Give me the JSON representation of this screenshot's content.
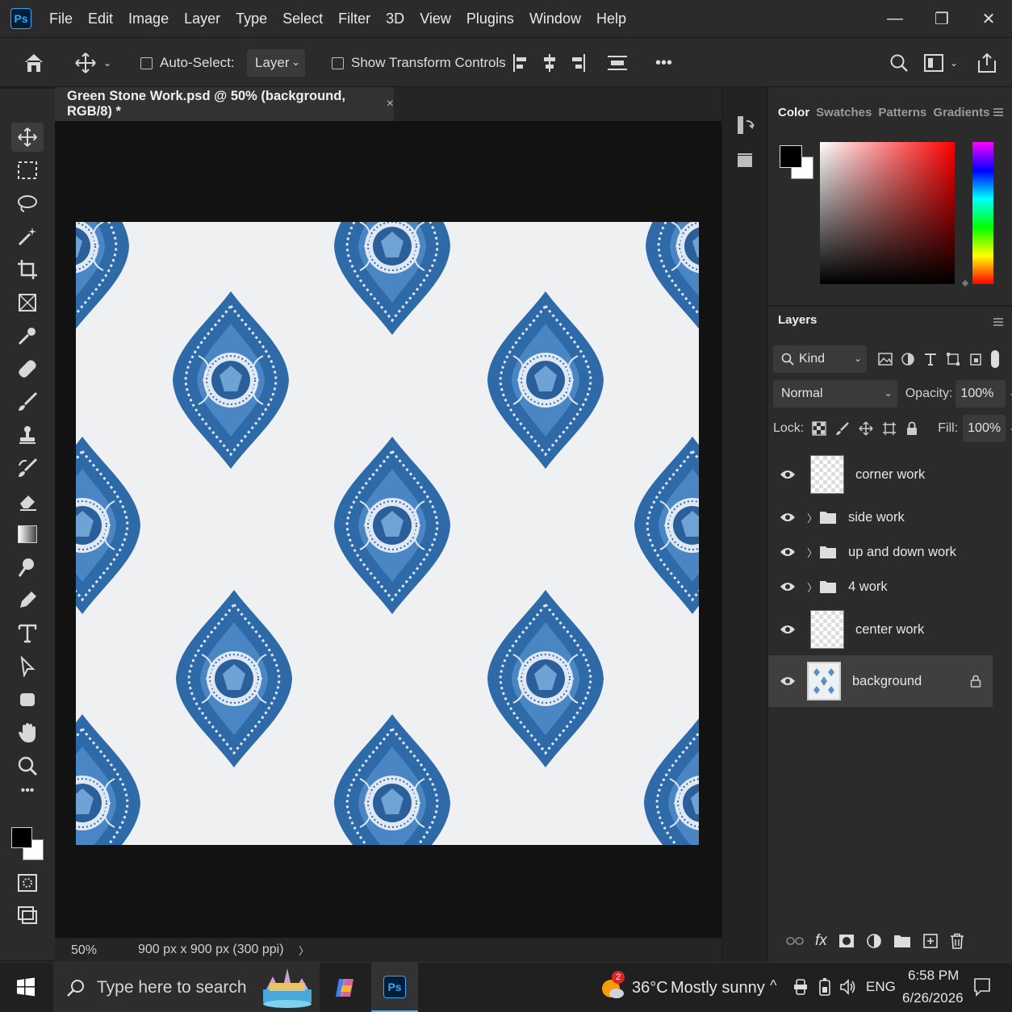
{
  "app": {
    "logo": "Ps"
  },
  "menu": [
    "File",
    "Edit",
    "Image",
    "Layer",
    "Type",
    "Select",
    "Filter",
    "3D",
    "View",
    "Plugins",
    "Window",
    "Help"
  ],
  "window_controls": {
    "minimize": "—",
    "restore": "❐",
    "close": "✕"
  },
  "options": {
    "auto_select_label": "Auto-Select:",
    "layer_select_value": "Layer",
    "show_transform_label": "Show Transform Controls",
    "more": "•••"
  },
  "document": {
    "tab_title": "Green Stone Work.psd @ 50% (background, RGB/8) *",
    "close": "×",
    "zoom": "50%",
    "doc_info": "900 px x 900 px (300 ppi)",
    "status_arrow": "〉"
  },
  "color_panel": {
    "tabs": [
      "Color",
      "Swatches",
      "Patterns",
      "Gradients"
    ],
    "active_tab": "Color",
    "foreground": "#000000",
    "background": "#ffffff"
  },
  "layers_panel": {
    "title": "Layers",
    "filter_kind": "Kind",
    "blend_mode": "Normal",
    "opacity_label": "Opacity:",
    "opacity_value": "100%",
    "lock_label": "Lock:",
    "fill_label": "Fill:",
    "fill_value": "100%",
    "layers": [
      {
        "name": "corner work",
        "type": "layer"
      },
      {
        "name": "side work",
        "type": "group"
      },
      {
        "name": "up and down work",
        "type": "group"
      },
      {
        "name": "4 work",
        "type": "group"
      },
      {
        "name": "center work",
        "type": "layer"
      },
      {
        "name": "background",
        "type": "background",
        "selected": true,
        "locked": true
      }
    ]
  },
  "taskbar": {
    "search_placeholder": "Type here to search",
    "weather_temp": "36°C",
    "weather_desc": "Mostly sunny",
    "weather_badge": "2",
    "language": "ENG",
    "time": "6:58 PM",
    "date": "6/26/2026"
  },
  "colors": {
    "accent": "#31a8ff",
    "pattern_blue": "#2f6aa8"
  }
}
